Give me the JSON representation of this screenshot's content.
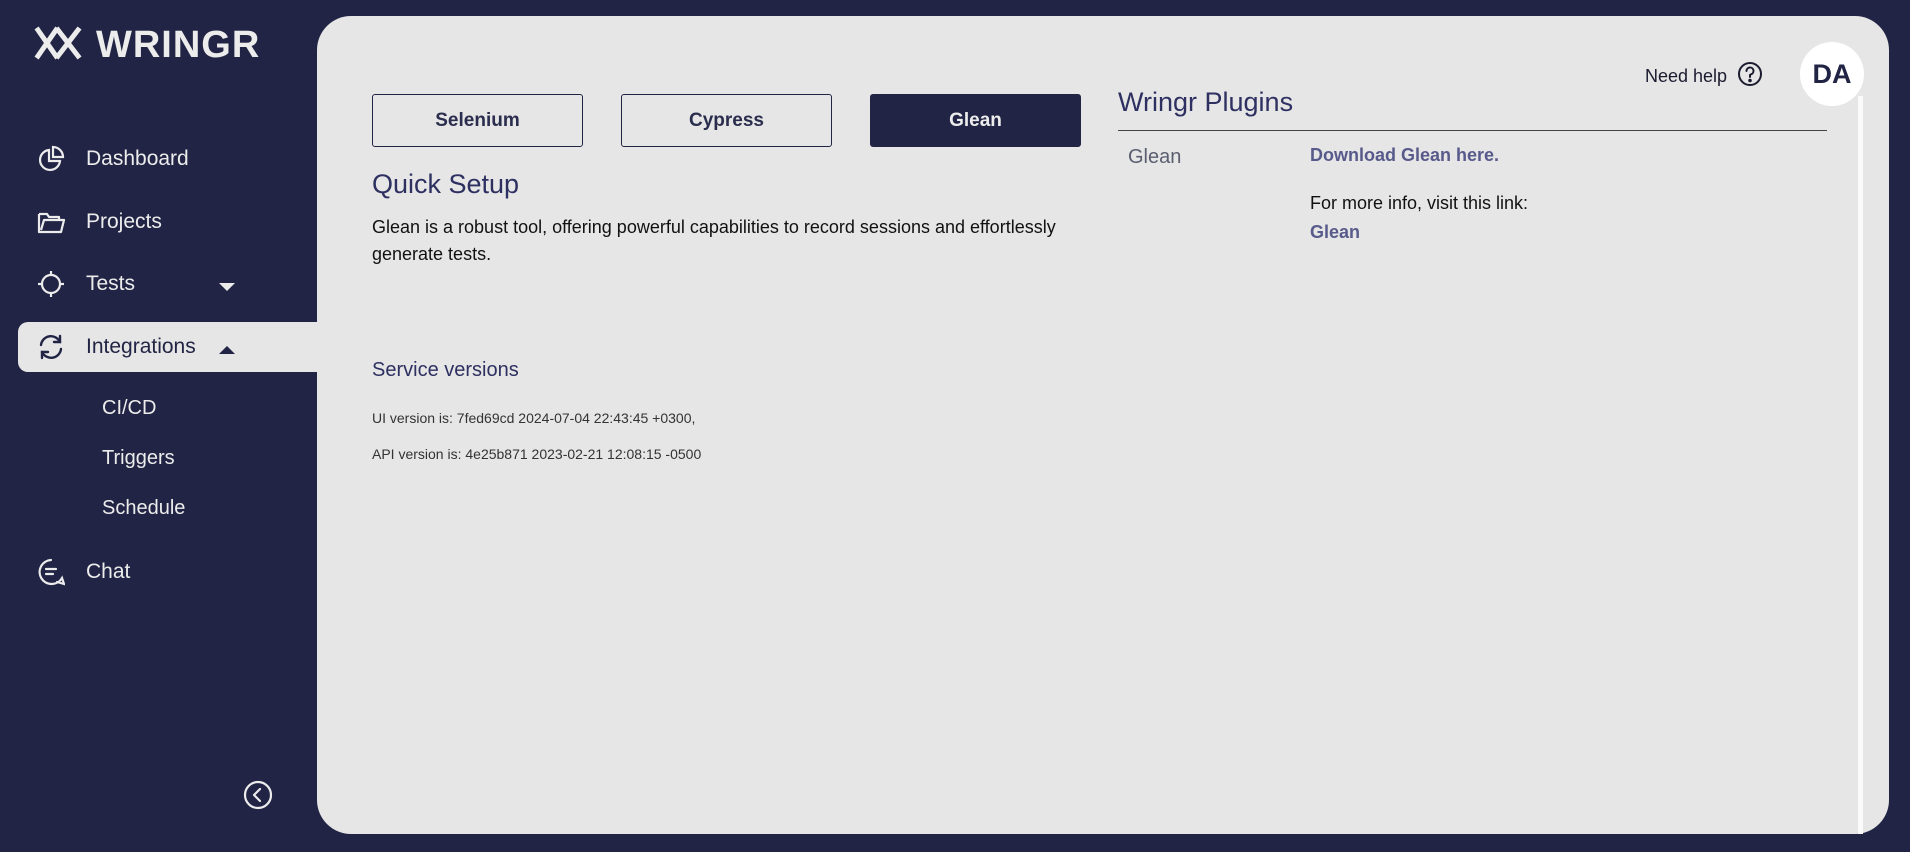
{
  "brand": {
    "name": "WRINGR"
  },
  "sidebar": {
    "items": [
      {
        "label": "Dashboard",
        "icon": "chart-pie-icon"
      },
      {
        "label": "Projects",
        "icon": "folder-icon"
      },
      {
        "label": "Tests",
        "icon": "crosshair-icon"
      },
      {
        "label": "Integrations",
        "icon": "sync-icon"
      },
      {
        "label": "Chat",
        "icon": "chat-icon"
      }
    ],
    "subitems": [
      "CI/CD",
      "Triggers",
      "Schedule"
    ],
    "collapse_icon": "chevron-left-icon"
  },
  "tabs": [
    "Selenium",
    "Cypress",
    "Glean"
  ],
  "selected_tab": "Glean",
  "quick_setup": {
    "title": "Quick Setup",
    "description": "Glean is a robust tool, offering powerful capabilities to record sessions and effortlessly generate tests."
  },
  "service_versions": {
    "title": "Service versions",
    "ui": "UI version is: 7fed69cd 2024-07-04 22:43:45 +0300,",
    "api": "API version is: 4e25b871 2023-02-21 12:08:15 -0500"
  },
  "header": {
    "help_label": "Need help",
    "avatar_initials": "DA"
  },
  "plugins": {
    "title": "Wringr Plugins",
    "name": "Glean",
    "download_label": "Download Glean here.",
    "info_label": "For more info, visit this link:",
    "info_link": "Glean"
  },
  "colors": {
    "navy": "#212444",
    "panel": "#e6e6e6",
    "heading": "#2d3060",
    "link": "#575a8a"
  }
}
